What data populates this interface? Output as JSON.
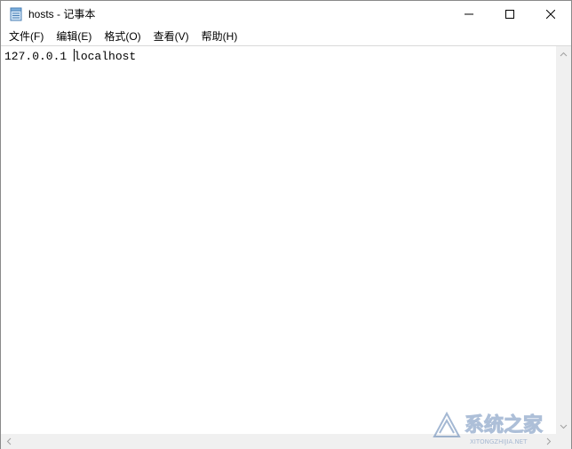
{
  "window": {
    "title": "hosts - 记事本",
    "icons": {
      "app": "notepad-icon",
      "minimize": "minimize-icon",
      "maximize": "maximize-icon",
      "close": "close-icon"
    }
  },
  "menubar": {
    "items": [
      {
        "label": "文件(F)"
      },
      {
        "label": "编辑(E)"
      },
      {
        "label": "格式(O)"
      },
      {
        "label": "查看(V)"
      },
      {
        "label": "帮助(H)"
      }
    ]
  },
  "editor": {
    "before_caret": "127.0.0.1 ",
    "after_caret": "localhost"
  },
  "watermark": {
    "text": "系统之家",
    "subtext": "XITONGZHIJIA.NET"
  }
}
